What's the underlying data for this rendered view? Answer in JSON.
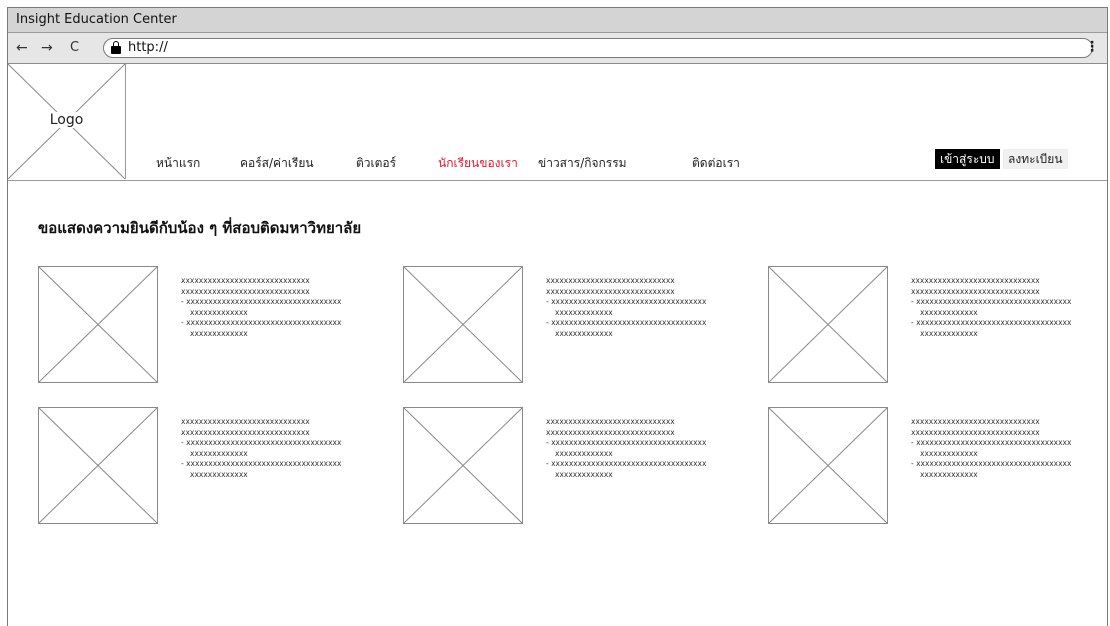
{
  "window": {
    "title": "Insight Education Center"
  },
  "addressbar": {
    "back_glyph": "←",
    "forward_glyph": "→",
    "reload_glyph": "C",
    "url": "http://",
    "menu_glyph": "⋮"
  },
  "header": {
    "logo_label": "Logo",
    "menu": [
      {
        "label": "หน้าแรก",
        "active": false
      },
      {
        "label": "คอร์ส/ค่าเรียน",
        "active": false
      },
      {
        "label": "ติวเตอร์",
        "active": false
      },
      {
        "label": "นักเรียนของเรา",
        "active": true
      },
      {
        "label": "ข่าวสาร/กิจกรรม",
        "active": false
      },
      {
        "label": "ติดต่อเรา",
        "active": false
      }
    ],
    "login_label": "เข้าสู่ระบบ",
    "register_label": "ลงทะเบียน",
    "active_color": "#e8142b"
  },
  "main": {
    "title": "ขอแสดงความยินดีกับน้อง ๆ ที่สอบติดมหาวิทยาลัย",
    "cards": [
      {
        "line1": "xxxxxxxxxxxxxxxxxxxxxxxxxxxxx",
        "line2": "xxxxxxxxxxxxxxxxxxxxxxxxxxxxx",
        "line3": "- xxxxxxxxxxxxxxxxxxxxxxxxxxxxxxxxxxx",
        "line4": "xxxxxxxxxxxxx",
        "line5": "- xxxxxxxxxxxxxxxxxxxxxxxxxxxxxxxxxxx",
        "line6": "xxxxxxxxxxxxx"
      },
      {
        "line1": "xxxxxxxxxxxxxxxxxxxxxxxxxxxxx",
        "line2": "xxxxxxxxxxxxxxxxxxxxxxxxxxxxx",
        "line3": "- xxxxxxxxxxxxxxxxxxxxxxxxxxxxxxxxxxx",
        "line4": "xxxxxxxxxxxxx",
        "line5": "- xxxxxxxxxxxxxxxxxxxxxxxxxxxxxxxxxxx",
        "line6": "xxxxxxxxxxxxx"
      },
      {
        "line1": "xxxxxxxxxxxxxxxxxxxxxxxxxxxxx",
        "line2": "xxxxxxxxxxxxxxxxxxxxxxxxxxxxx",
        "line3": "- xxxxxxxxxxxxxxxxxxxxxxxxxxxxxxxxxxx",
        "line4": "xxxxxxxxxxxxx",
        "line5": "- xxxxxxxxxxxxxxxxxxxxxxxxxxxxxxxxxxx",
        "line6": "xxxxxxxxxxxxx"
      },
      {
        "line1": "xxxxxxxxxxxxxxxxxxxxxxxxxxxxx",
        "line2": "xxxxxxxxxxxxxxxxxxxxxxxxxxxxx",
        "line3": "- xxxxxxxxxxxxxxxxxxxxxxxxxxxxxxxxxxx",
        "line4": "xxxxxxxxxxxxx",
        "line5": "- xxxxxxxxxxxxxxxxxxxxxxxxxxxxxxxxxxx",
        "line6": "xxxxxxxxxxxxx"
      },
      {
        "line1": "xxxxxxxxxxxxxxxxxxxxxxxxxxxxx",
        "line2": "xxxxxxxxxxxxxxxxxxxxxxxxxxxxx",
        "line3": "- xxxxxxxxxxxxxxxxxxxxxxxxxxxxxxxxxxx",
        "line4": "xxxxxxxxxxxxx",
        "line5": "- xxxxxxxxxxxxxxxxxxxxxxxxxxxxxxxxxxx",
        "line6": "xxxxxxxxxxxxx"
      },
      {
        "line1": "xxxxxxxxxxxxxxxxxxxxxxxxxxxxx",
        "line2": "xxxxxxxxxxxxxxxxxxxxxxxxxxxxx",
        "line3": "- xxxxxxxxxxxxxxxxxxxxxxxxxxxxxxxxxxx",
        "line4": "xxxxxxxxxxxxx",
        "line5": "- xxxxxxxxxxxxxxxxxxxxxxxxxxxxxxxxxxx",
        "line6": "xxxxxxxxxxxxx"
      }
    ]
  }
}
